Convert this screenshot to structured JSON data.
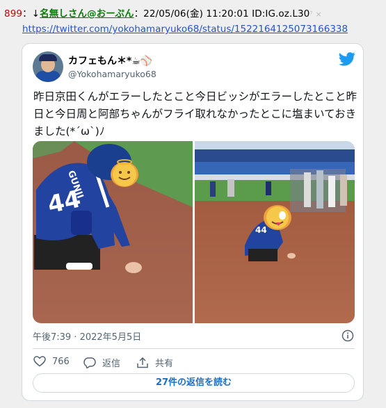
{
  "post": {
    "number": "899",
    "separator": "：",
    "arrow": "↓",
    "name": "名無しさん@おーぷん",
    "meta": "：22/05/06(金) 11:20:01 ID:IG.oz.L30",
    "icons": "⁷ ×",
    "link": "https://twitter.com/yokohamaryuko68/status/1522164125073166338"
  },
  "tweet": {
    "display_name": "カフェもん＊*☕⚾",
    "handle": "@Yokohamaryuko68",
    "text": "昨日京田くんがエラーしたとこと今日ビッシがエラーしたとこと昨日と今日周と阿部ちゃんがフライ取れなかったとこに塩まいておきました(*´ω`)ﾉ",
    "timestamp": "午後7:39 · 2022年5月5日",
    "likes": "766",
    "reply_label": "返信",
    "share_label": "共有",
    "read_replies": "27件の返信を読む",
    "media": [
      {
        "jersey_name": "GUNJI",
        "jersey_number": "44"
      },
      {
        "jersey_number": "44"
      }
    ]
  },
  "colors": {
    "post_number": "#cc0000",
    "post_name": "#0a7a0a",
    "link": "#2255cc",
    "twitter_blue": "#1d9bf0",
    "muted": "#536471"
  }
}
